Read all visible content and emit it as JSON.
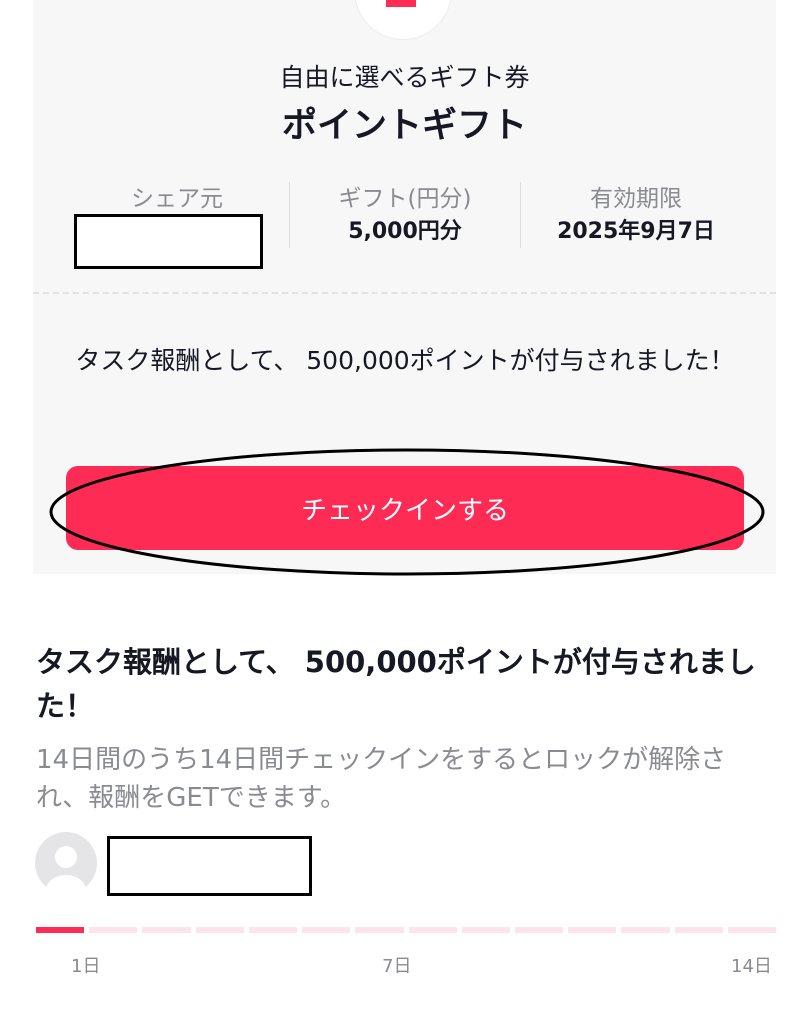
{
  "gift": {
    "subtitle": "自由に選べるギフト券",
    "title": "ポイントギフト",
    "info": [
      {
        "label": "シェア元",
        "value": ""
      },
      {
        "label": "ギフト(円分)",
        "value": "5,000円分"
      },
      {
        "label": "有効期限",
        "value": "2025年9月7日"
      }
    ],
    "message": "タスク報酬として、 500,000ポイントが付与されました！",
    "checkin_button": "チェックインする"
  },
  "task": {
    "heading": "タスク報酬として、 500,000ポイントが付与されました！",
    "description": "14日間のうち14日間チェックインをするとロックが解除され、報酬をGETできます。",
    "progress": {
      "completed_days": 1,
      "total_days": 14,
      "labels": [
        "1日",
        "7日",
        "14日"
      ]
    }
  },
  "colors": {
    "accent": "#fe2c55",
    "card_bg": "#f7f7f8",
    "muted_text": "#8a8b91"
  }
}
